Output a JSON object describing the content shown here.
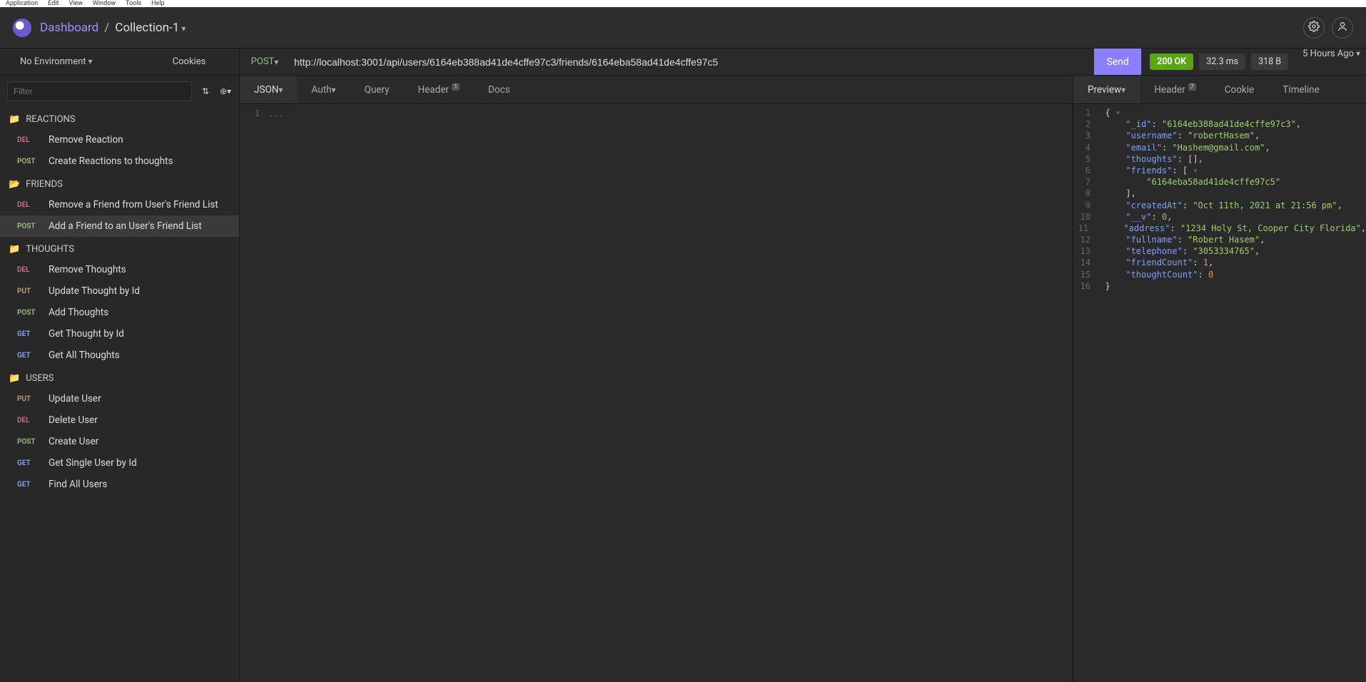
{
  "os_menu": [
    "Application",
    "Edit",
    "View",
    "Window",
    "Tools",
    "Help"
  ],
  "breadcrumb": {
    "dashboard": "Dashboard",
    "collection": "Collection-1"
  },
  "sidebar": {
    "environment_label": "No Environment",
    "cookies_label": "Cookies",
    "filter_placeholder": "Filter",
    "groups": [
      {
        "name": "REACTIONS",
        "items": [
          {
            "method": "DEL",
            "label": "Remove Reaction"
          },
          {
            "method": "POST",
            "label": "Create Reactions to thoughts"
          }
        ]
      },
      {
        "name": "FRIENDS",
        "open": true,
        "items": [
          {
            "method": "DEL",
            "label": "Remove a Friend from User's Friend List"
          },
          {
            "method": "POST",
            "label": "Add a Friend to an User's Friend List",
            "active": true
          }
        ]
      },
      {
        "name": "THOUGHTS",
        "items": [
          {
            "method": "DEL",
            "label": "Remove Thoughts"
          },
          {
            "method": "PUT",
            "label": "Update Thought by Id"
          },
          {
            "method": "POST",
            "label": "Add Thoughts"
          },
          {
            "method": "GET",
            "label": "Get Thought by Id"
          },
          {
            "method": "GET",
            "label": "Get All Thoughts"
          }
        ]
      },
      {
        "name": "USERS",
        "items": [
          {
            "method": "PUT",
            "label": "Update User"
          },
          {
            "method": "DEL",
            "label": "Delete User"
          },
          {
            "method": "POST",
            "label": "Create User"
          },
          {
            "method": "GET",
            "label": "Get Single User by Id"
          },
          {
            "method": "GET",
            "label": "Find All Users"
          }
        ]
      }
    ]
  },
  "request": {
    "method": "POST",
    "url": "http://localhost:3001/api/users/6164eb388ad41de4cffe97c3/friends/6164eba58ad41de4cffe97c5",
    "send_label": "Send",
    "body_preview": "..."
  },
  "request_tabs": {
    "json": "JSON",
    "auth": "Auth",
    "query": "Query",
    "header": "Header",
    "header_badge": "1",
    "docs": "Docs"
  },
  "response": {
    "status_code": "200",
    "status_text": "OK",
    "time": "32.3 ms",
    "size": "318 B",
    "timestamp": "5 Hours Ago",
    "tabs": {
      "preview": "Preview",
      "header": "Header",
      "header_badge": "7",
      "cookie": "Cookie",
      "timeline": "Timeline"
    },
    "json_lines": [
      {
        "n": 1,
        "txt": "{",
        "fold": true
      },
      {
        "n": 2,
        "txt": "    \"_id\": \"6164eb388ad41de4cffe97c3\","
      },
      {
        "n": 3,
        "txt": "    \"username\": \"robertHasem\","
      },
      {
        "n": 4,
        "txt": "    \"email\": \"Hashem@gmail.com\","
      },
      {
        "n": 5,
        "txt": "    \"thoughts\": [],"
      },
      {
        "n": 6,
        "txt": "    \"friends\": [",
        "fold": true
      },
      {
        "n": 7,
        "txt": "        \"6164eba58ad41de4cffe97c5\""
      },
      {
        "n": 8,
        "txt": "    ],"
      },
      {
        "n": 9,
        "txt": "    \"createdAt\": \"Oct 11th, 2021 at 21:56 pm\","
      },
      {
        "n": 10,
        "txt": "    \"__v\": 0,"
      },
      {
        "n": 11,
        "txt": "    \"address\": \"1234 Holy St, Cooper City Florida\","
      },
      {
        "n": 12,
        "txt": "    \"fullname\": \"Robert Hasem\","
      },
      {
        "n": 13,
        "txt": "    \"telephone\": \"3053334765\","
      },
      {
        "n": 14,
        "txt": "    \"friendCount\": 1,"
      },
      {
        "n": 15,
        "txt": "    \"thoughtCount\": 0"
      },
      {
        "n": 16,
        "txt": "}"
      }
    ]
  }
}
